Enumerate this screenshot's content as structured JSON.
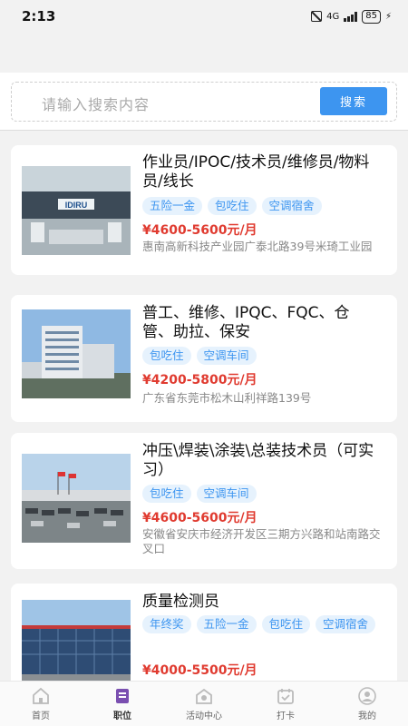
{
  "status_bar": {
    "time": "2:13",
    "battery": "85",
    "network": "4G"
  },
  "search": {
    "placeholder": "请输入搜索内容",
    "button_label": "搜索"
  },
  "jobs": [
    {
      "title": "作业员/IPOC/技术员/维修员/物料员/线长",
      "tags": [
        "五险一金",
        "包吃住",
        "空调宿舍"
      ],
      "salary": "¥4600-5600元/月",
      "address": "惠南高新科技产业园广泰北路39号米琦工业园",
      "image": "office-lobby-photo"
    },
    {
      "title": "普工、维修、IPQC、FQC、仓管、助拉、保安",
      "tags": [
        "包吃住",
        "空调车间"
      ],
      "salary": "¥4200-5800元/月",
      "address": "广东省东莞市松木山利祥路139号",
      "image": "factory-building-photo"
    },
    {
      "title": "冲压\\焊装\\涂装\\总装技术员（可实习）",
      "tags": [
        "包吃住",
        "空调车间"
      ],
      "salary": "¥4600-5600元/月",
      "address": "安徽省安庆市经济开发区三期方兴路和站南路交叉口",
      "image": "plant-parking-photo"
    },
    {
      "title": "质量检测员",
      "tags": [
        "年终奖",
        "五险一金",
        "包吃住",
        "空调宿舍"
      ],
      "salary": "¥4000-5500元/月",
      "address": "",
      "image": "glass-building-photo"
    }
  ],
  "tab_bar": {
    "items": [
      {
        "label": "首页",
        "icon": "home-icon",
        "active": false
      },
      {
        "label": "职位",
        "icon": "jobs-icon",
        "active": true
      },
      {
        "label": "活动中心",
        "icon": "activity-icon",
        "active": false
      },
      {
        "label": "打卡",
        "icon": "calendar-icon",
        "active": false
      },
      {
        "label": "我的",
        "icon": "profile-icon",
        "active": false
      }
    ]
  },
  "colors": {
    "accent": "#3d95f0",
    "salary": "#e03b30",
    "tag_bg": "#e6f2fd"
  }
}
